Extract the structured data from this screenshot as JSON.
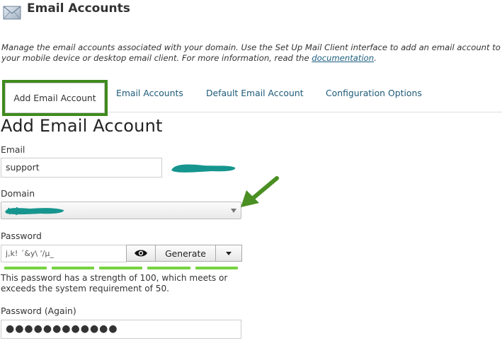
{
  "header": {
    "title": "Email Accounts",
    "icon": "envelope-icon"
  },
  "description": {
    "text": "Manage the email accounts associated with your domain. Use the Set Up Mail Client interface to add an email account to your mobile device or desktop email client. For more information, read the ",
    "link": "documentation",
    "tail": "."
  },
  "tabs": [
    {
      "label": "Add Email Account",
      "active": true
    },
    {
      "label": "Email Accounts",
      "active": false
    },
    {
      "label": "Default Email Account",
      "active": false
    },
    {
      "label": "Configuration Options",
      "active": false
    }
  ],
  "form": {
    "section_title": "Add Email Account",
    "email_label": "Email",
    "email_value": "support",
    "domain_label": "Domain",
    "password_label": "Password",
    "password_value": "j,k! ´&y\\ '/µ_",
    "show_password_icon": "eye-icon",
    "generate_label": "Generate",
    "generate_menu_icon": "caret-down-icon",
    "strength_fraction": 1.0,
    "strength_text": "This password has a strength of 100, which meets or exceeds the system requirement of 50.",
    "password_again_label": "Password (Again)",
    "password_again_value": "●●●●●●●●●●●●"
  },
  "colors": {
    "highlight_box": "#3f8a1c",
    "arrow": "#4a8f22",
    "redaction": "#16958f",
    "strength_bar": "#76d341",
    "tab_link": "#1d5a78"
  }
}
